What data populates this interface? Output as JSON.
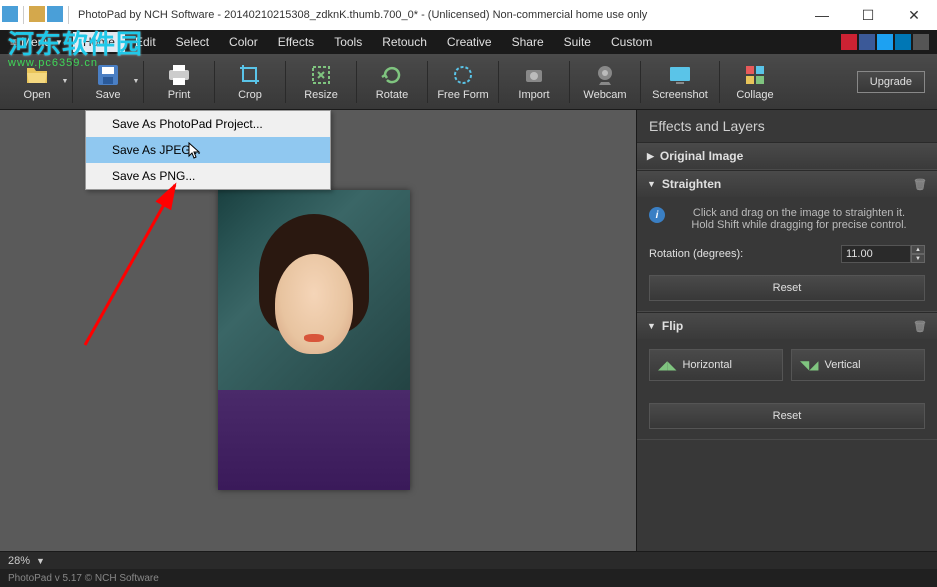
{
  "titlebar": {
    "text": "PhotoPad by NCH Software - 20140210215308_zdknK.thumb.700_0* - (Unlicensed) Non-commercial home use only"
  },
  "menubar": {
    "menu_label": "Menu",
    "items": [
      "Home",
      "Edit",
      "Select",
      "Color",
      "Effects",
      "Tools",
      "Retouch",
      "Creative",
      "Share",
      "Suite",
      "Custom"
    ]
  },
  "toolbar": {
    "items": [
      "Open",
      "Save",
      "Print",
      "Crop",
      "Resize",
      "Rotate",
      "Free Form",
      "Import",
      "Webcam",
      "Screenshot",
      "Collage"
    ],
    "upgrade": "Upgrade"
  },
  "dropdown": {
    "items": [
      "Save As PhotoPad Project...",
      "Save As JPEG...",
      "Save As PNG..."
    ]
  },
  "panel": {
    "title": "Effects and Layers",
    "original": {
      "label": "Original Image"
    },
    "straighten": {
      "label": "Straighten",
      "info1": "Click and drag on the image to straighten it.",
      "info2": "Hold Shift while dragging for precise control.",
      "rotation_label": "Rotation (degrees):",
      "rotation_value": "11.00",
      "reset": "Reset"
    },
    "flip": {
      "label": "Flip",
      "horizontal": "Horizontal",
      "vertical": "Vertical",
      "reset": "Reset"
    }
  },
  "status": {
    "zoom": "28%"
  },
  "footer": {
    "text": "PhotoPad v 5.17  © NCH Software"
  },
  "watermark": {
    "line1": "河东软件园",
    "line2": "www.pc6359.cn"
  }
}
